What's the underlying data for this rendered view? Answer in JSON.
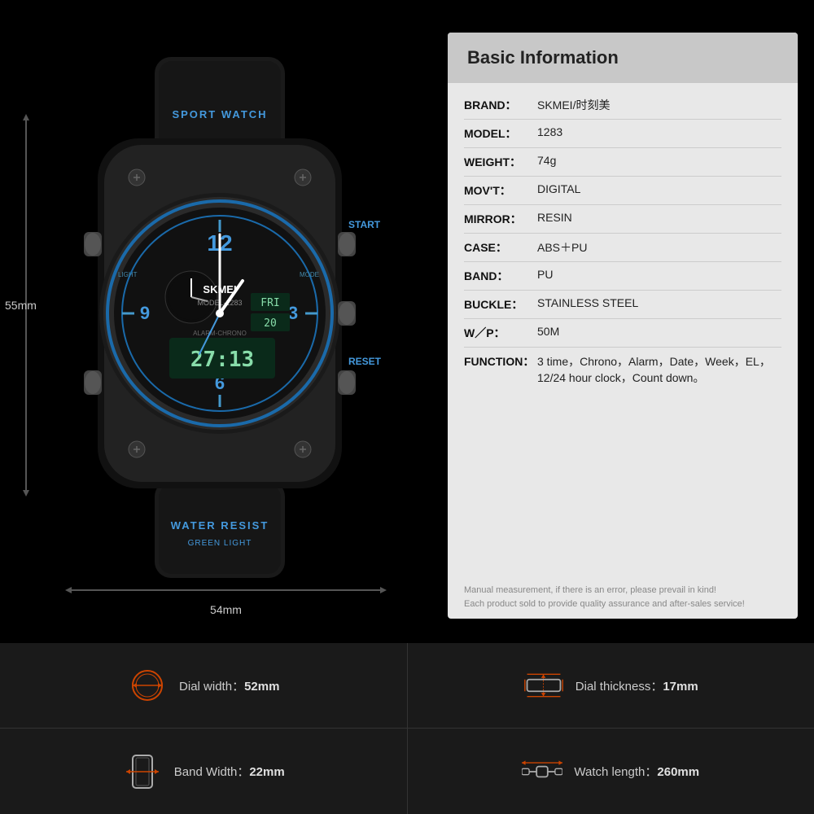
{
  "page": {
    "background": "#000000"
  },
  "info_card": {
    "title": "Basic Information",
    "rows": [
      {
        "label": "BRAND：",
        "value": "SKMEI/时刻美"
      },
      {
        "label": "MODEL：",
        "value": "1283"
      },
      {
        "label": "WEIGHT：",
        "value": "74g"
      },
      {
        "label": "MOV'T：",
        "value": "DIGITAL"
      },
      {
        "label": "MIRROR：",
        "value": "RESIN"
      },
      {
        "label": "CASE：",
        "value": "ABS＋PU"
      },
      {
        "label": "BAND：",
        "value": "PU"
      },
      {
        "label": "BUCKLE：",
        "value": "STAINLESS STEEL"
      },
      {
        "label": "W／P：",
        "value": "50M"
      },
      {
        "label": "FUNCTION：",
        "value": "3 time，Chrono，Alarm，Date，Week，EL，12/24 hour clock，Count down。"
      }
    ],
    "note_line1": "Manual measurement, if there is an error, please prevail in kind!",
    "note_line2": "Each product sold to provide quality assurance and after-sales service!"
  },
  "dimensions": {
    "height": "55mm",
    "width": "54mm"
  },
  "specs": [
    {
      "label": "Dial width：",
      "value": "52mm",
      "icon": "dial-width-icon"
    },
    {
      "label": "Dial thickness：",
      "value": "17mm",
      "icon": "dial-thickness-icon"
    },
    {
      "label": "Band Width：",
      "value": "22mm",
      "icon": "band-width-icon"
    },
    {
      "label": "Watch length：",
      "value": "260mm",
      "icon": "watch-length-icon"
    }
  ]
}
